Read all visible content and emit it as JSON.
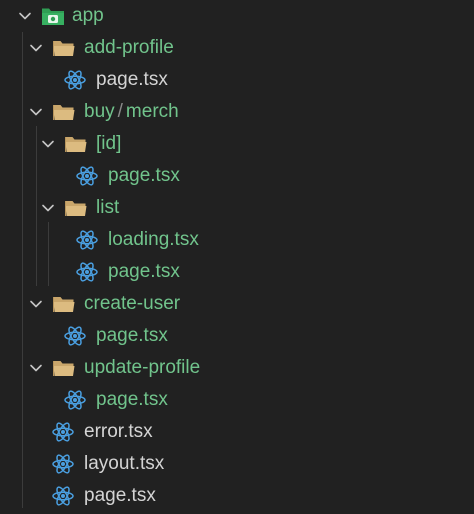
{
  "explorer": {
    "app": {
      "label": "app"
    },
    "add_profile": {
      "label": "add-profile",
      "page": "page.tsx"
    },
    "buy": {
      "label_a": "buy",
      "separator": "/",
      "label_b": "merch",
      "id": {
        "label": "[id]",
        "page": "page.tsx"
      },
      "list": {
        "label": "list",
        "loading": "loading.tsx",
        "page": "page.tsx"
      }
    },
    "create_user": {
      "label": "create-user",
      "page": "page.tsx"
    },
    "update_profile": {
      "label": "update-profile",
      "page": "page.tsx"
    },
    "root_files": {
      "error": "error.tsx",
      "layout": "layout.tsx",
      "page": "page.tsx"
    }
  },
  "colors": {
    "background": "#212121",
    "folder_label": "#71c48c",
    "modified_file_label": "#71c48c",
    "file_label": "#d4d4d4",
    "react_icon": "#4a9fe0",
    "folder_icon": "#d8b67a",
    "app_folder_icon": "#2f9e54"
  },
  "icons": {
    "chevron": "chevron-down-icon",
    "folder": "folder-open-icon",
    "app_folder": "app-folder-icon",
    "react_file": "react-icon"
  }
}
